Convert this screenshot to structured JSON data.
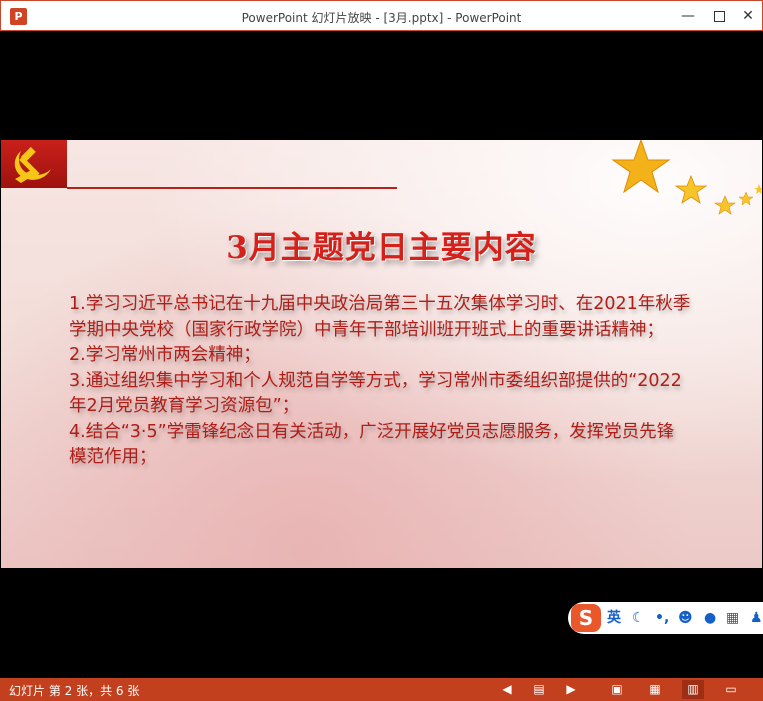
{
  "window": {
    "title": "PowerPoint 幻灯片放映 - [3月.pptx] - PowerPoint",
    "app_icon": "P"
  },
  "slide": {
    "title": "3月主题党日主要内容",
    "items": [
      "1.学习习近平总书记在十九届中央政治局第三十五次集体学习时、在2021年秋季学期中央党校（国家行政学院）中青年干部培训班开班式上的重要讲话精神；",
      "2.学习常州市两会精神；",
      "3.通过组织集中学习和个人规范自学等方式，学习常州市委组织部提供的“2022年2月党员教育学习资源包”；",
      "4.结合“3·5”学雷锋纪念日有关活动，广泛开展好党员志愿服务，发挥党员先锋模范作用；"
    ]
  },
  "ime": {
    "logo": "S",
    "mode": "英",
    "punct": "•,"
  },
  "statusbar": {
    "text": "幻灯片 第 2 张，共 6 张"
  },
  "colors": {
    "accent": "#c3401f",
    "title_red": "#d6201a",
    "body_red": "#b01d17"
  }
}
